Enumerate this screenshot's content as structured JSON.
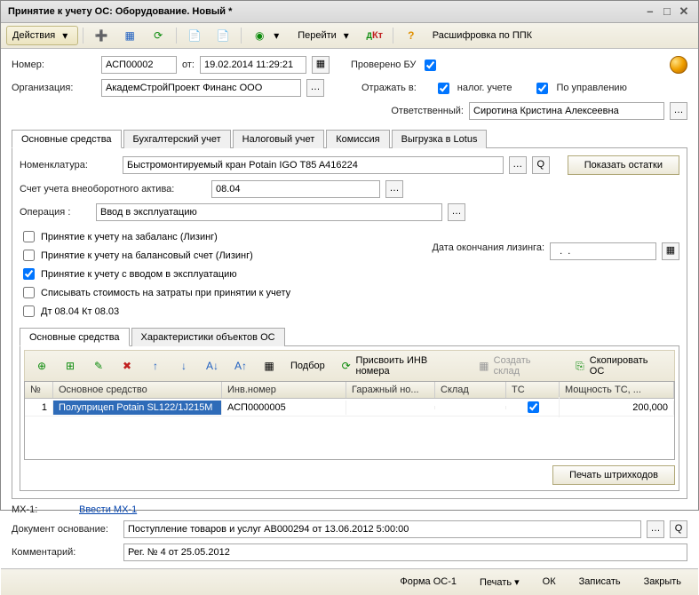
{
  "title": "Принятие к учету ОС: Оборудование. Новый *",
  "toolbar": {
    "actions": "Действия",
    "goto": "Перейти",
    "decode": "Расшифровка по ППК"
  },
  "header": {
    "number_lbl": "Номер:",
    "number": "АСП00002",
    "from_lbl": "от:",
    "date": "19.02.2014 11:29:21",
    "checked_bu": "Проверено БУ",
    "org_lbl": "Организация:",
    "org": "АкадемСтройПроект Финанс ООО",
    "reflect_lbl": "Отражать в:",
    "reflect_tax": "налог. учете",
    "reflect_mgmt": "По управлению",
    "responsible_lbl": "Ответственный:",
    "responsible": "Сиротина Кристина Алексеевна"
  },
  "main_tabs": [
    "Основные средства",
    "Бухгалтерский учет",
    "Налоговый учет",
    "Комиссия",
    "Выгрузка в Lotus"
  ],
  "main": {
    "nomen_lbl": "Номенклатура:",
    "nomen": "Быстромонтируемый кран Potain IGO T85 A416224",
    "show_balance": "Показать остатки",
    "account_lbl": "Счет учета внеоборотного актива:",
    "account": "08.04",
    "operation_lbl": "Операция :",
    "operation": "Ввод в эксплуатацию",
    "chk_offbal": "Принятие к учету на забаланс (Лизинг)",
    "chk_bal": "Принятие к учету на балансовый счет (Лизинг)",
    "chk_commission": "Принятие к учету с вводом в эксплуатацию",
    "chk_writeoff": "Списывать стоимость на затраты при принятии к учету",
    "chk_dt": "Дт 08.04 Кт 08.03",
    "lease_end_lbl": "Дата окончания лизинга:",
    "lease_end": "  .  .    "
  },
  "sub_tabs": [
    "Основные средства",
    "Характеристики объектов ОС"
  ],
  "subtoolbar": {
    "pick": "Подбор",
    "assign_inv": "Присвоить ИНВ номера",
    "create_store": "Создать склад",
    "copy_os": "Скопировать ОС"
  },
  "table": {
    "headers": [
      "№",
      "Основное средство",
      "Инв.номер",
      "Гаражный но...",
      "Склад",
      "ТС",
      "Мощность ТС, ..."
    ],
    "rows": [
      {
        "n": "1",
        "os": "Полуприцеп Potain SL122/1J215M",
        "inv": "АСП0000005",
        "garage": "",
        "store": "",
        "tc": true,
        "power": "200,000"
      }
    ]
  },
  "print_barcodes": "Печать штрихкодов",
  "bottom": {
    "mx_lbl": "МХ-1:",
    "mx_link": "Ввести МХ-1",
    "basis_lbl": "Документ основание:",
    "basis": "Поступление товаров и услуг АВ000294 от 13.06.2012 5:00:00",
    "comment_lbl": "Комментарий:",
    "comment": "Рег. № 4 от 25.05.2012"
  },
  "footer": [
    "Форма ОС-1",
    "Печать",
    "ОК",
    "Записать",
    "Закрыть"
  ]
}
